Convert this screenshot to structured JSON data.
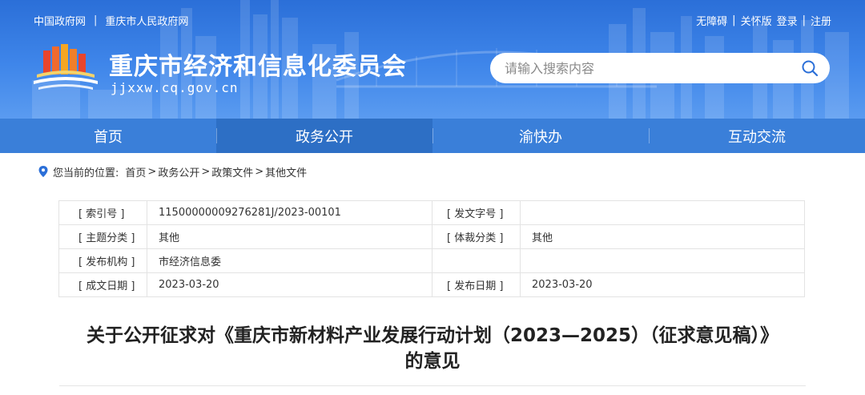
{
  "top_links": {
    "gov": "中国政府网",
    "sep": "|",
    "city": "重庆市人民政府网"
  },
  "user_links": {
    "accessibility": "无障碍",
    "sep1": "|",
    "elder": "关怀版",
    "login": "登录",
    "sep2": "|",
    "register": "注册"
  },
  "site": {
    "title": "重庆市经济和信息化委员会",
    "domain": "jjxxw.cq.gov.cn"
  },
  "search": {
    "placeholder": "请输入搜索内容"
  },
  "nav": {
    "items": [
      {
        "label": "首页"
      },
      {
        "label": "政务公开"
      },
      {
        "label": "渝快办"
      },
      {
        "label": "互动交流"
      }
    ],
    "active_index": 1
  },
  "breadcrumb": {
    "label": "您当前的位置:",
    "items": [
      "首页",
      "政务公开",
      "政策文件",
      "其他文件"
    ],
    "sep": ">"
  },
  "meta": {
    "rows": [
      {
        "k1": "[ 索引号 ]",
        "v1": "11500000009276281J/2023-00101",
        "k2": "[ 发文字号 ]",
        "v2": ""
      },
      {
        "k1": "[ 主题分类 ]",
        "v1": "其他",
        "k2": "[ 体裁分类 ]",
        "v2": "其他"
      },
      {
        "k1": "[ 发布机构 ]",
        "v1": "市经济信息委",
        "k2": "",
        "v2": ""
      },
      {
        "k1": "[ 成文日期 ]",
        "v1": "2023-03-20",
        "k2": "[ 发布日期 ]",
        "v2": "2023-03-20"
      }
    ]
  },
  "article": {
    "title_line1": "关于公开征求对《重庆市新材料产业发展行动计划（2023—2025）（征求意见稿）》",
    "title_line2": "的意见"
  },
  "colors": {
    "header_blue": "#3f86ea",
    "nav_blue": "#3a7fd9",
    "nav_active": "#2d6fc5",
    "pin_blue": "#2b6fd8"
  }
}
